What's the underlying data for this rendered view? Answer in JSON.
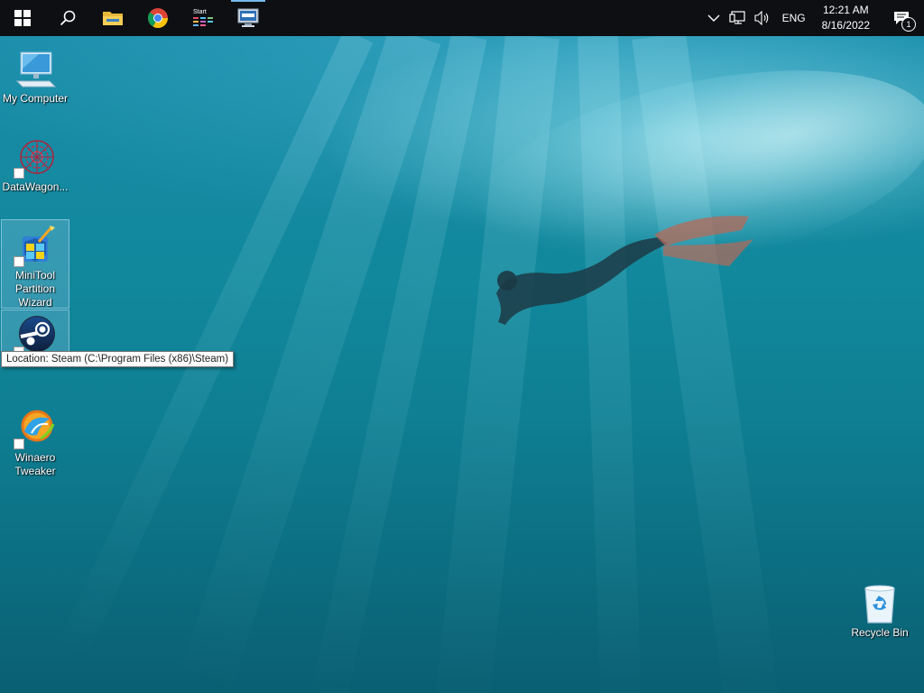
{
  "taskbar": {
    "start_label": "Start",
    "apps": [
      {
        "name": "search",
        "icon": "search-icon"
      },
      {
        "name": "file-explorer",
        "icon": "folder-icon"
      },
      {
        "name": "chrome",
        "icon": "chrome-icon"
      },
      {
        "name": "start-app",
        "icon": "start-app-icon",
        "label": "Start"
      },
      {
        "name": "remote-desktop",
        "icon": "remote-desktop-icon",
        "active": true
      }
    ],
    "tray": {
      "language": "ENG",
      "time": "12:21 AM",
      "date": "8/16/2022",
      "notification_count": "1"
    }
  },
  "desktop": {
    "icons": [
      {
        "label": "My Computer"
      },
      {
        "label": "DataWagon..."
      },
      {
        "label": "MiniTool Partition Wizard"
      },
      {
        "label": ""
      },
      {
        "label": "Winaero Tweaker"
      },
      {
        "label": "Recycle Bin"
      }
    ],
    "tooltip": "Location: Steam (C:\\Program Files (x86)\\Steam)"
  },
  "colors": {
    "taskbar_bg": "#0d0f12",
    "accent": "#76b9ed",
    "water_top": "#1d8fae",
    "water_bottom": "#0a5f72"
  }
}
